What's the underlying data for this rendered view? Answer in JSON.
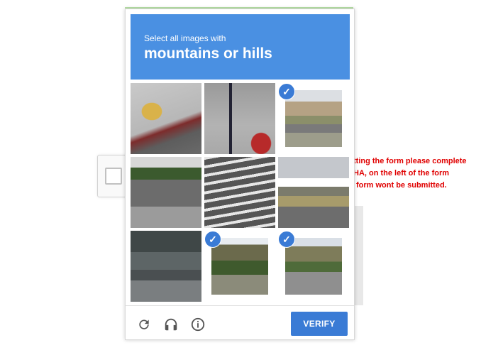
{
  "challenge": {
    "prompt_line1": "Select all images with",
    "prompt_line2": "mountains or hills",
    "tiles": [
      {
        "scene": "fire-hydrant",
        "selected": false
      },
      {
        "scene": "pole-and-hydrant",
        "selected": false
      },
      {
        "scene": "desert-road",
        "selected": true
      },
      {
        "scene": "road-with-trees",
        "selected": false
      },
      {
        "scene": "crosswalk",
        "selected": false
      },
      {
        "scene": "truck-on-highway",
        "selected": false
      },
      {
        "scene": "wall-and-road",
        "selected": false
      },
      {
        "scene": "mountain-with-trees",
        "selected": true
      },
      {
        "scene": "mountain-road",
        "selected": true
      }
    ],
    "verify_label": "VERIFY",
    "footer_icons": [
      "reload-icon",
      "audio-icon",
      "info-icon"
    ],
    "colors": {
      "header": "#4a90e2",
      "button": "#3a7bd5",
      "warning": "#e00000"
    }
  },
  "warning": {
    "line1": "tting the form please complete",
    "line2": "HA, on the left of the form",
    "line3": "form wont be submitted."
  }
}
